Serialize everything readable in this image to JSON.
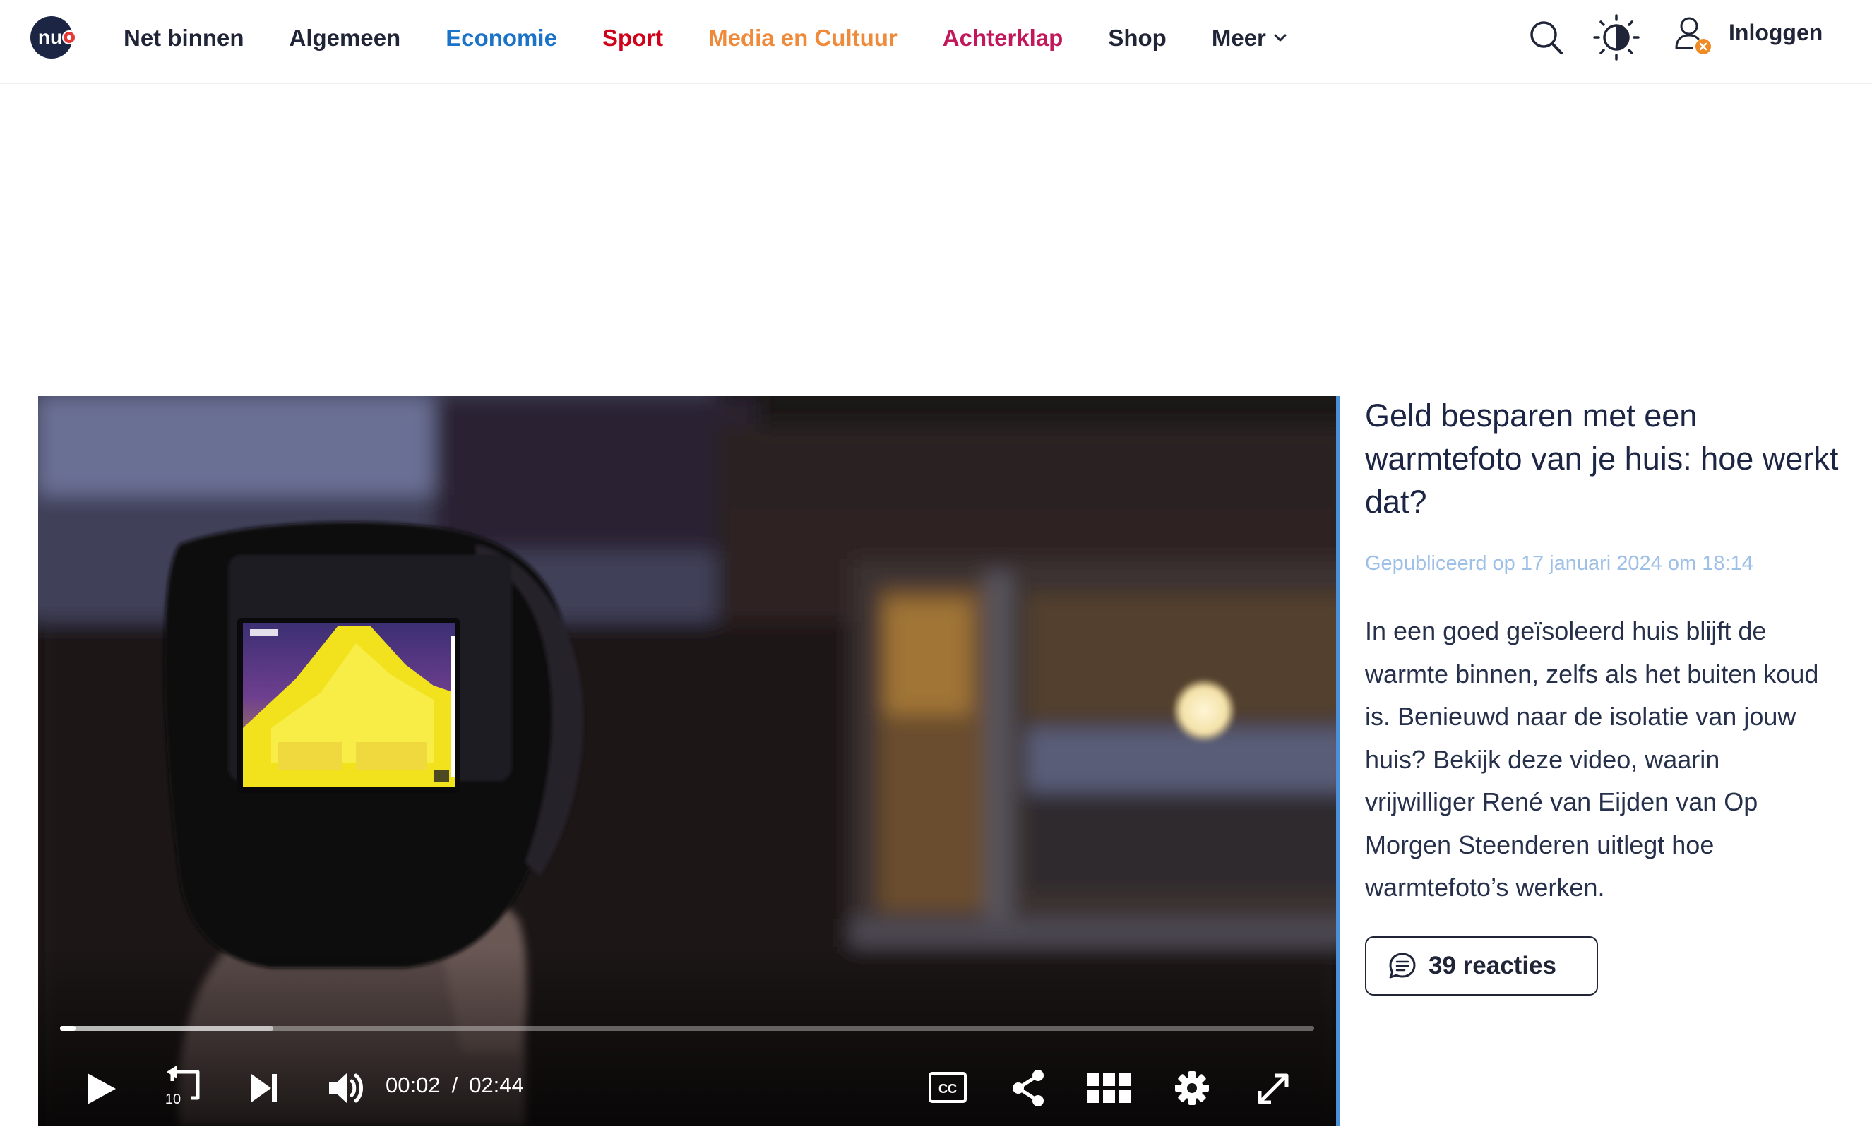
{
  "header": {
    "logo_text": "nu",
    "nav": [
      {
        "label": "Net binnen",
        "color": "#1f2437"
      },
      {
        "label": "Algemeen",
        "color": "#1f2437"
      },
      {
        "label": "Economie",
        "color": "#1a73c9"
      },
      {
        "label": "Sport",
        "color": "#d0021b"
      },
      {
        "label": "Media en Cultuur",
        "color": "#ee8a3a"
      },
      {
        "label": "Achterklap",
        "color": "#c2185b"
      },
      {
        "label": "Shop",
        "color": "#1f2437"
      },
      {
        "label": "Meer",
        "color": "#1f2437"
      }
    ],
    "login_label": "Inloggen",
    "icons": [
      "search-icon",
      "theme-toggle-icon",
      "user-icon"
    ]
  },
  "video": {
    "current_time": "00:02",
    "separator": "/",
    "duration": "02:44",
    "progress_fraction": 0.0122,
    "buffered_fraction": 0.17,
    "controls": [
      "play-icon",
      "rewind-10-icon",
      "skip-next-icon",
      "volume-icon",
      "captions-icon",
      "share-icon",
      "grid-icon",
      "settings-icon",
      "fullscreen-icon"
    ],
    "rewind_seconds": "10",
    "captions_label": "CC"
  },
  "article": {
    "title": "Geld besparen met een warmtefoto van je huis: hoe werkt dat?",
    "published": "Gepubliceerd op 17 januari 2024 om 18:14",
    "intro": "In een goed geïsoleerd huis blijft de warmte binnen, zelfs als het buiten koud is. Benieuwd naar de isolatie van jouw huis? Bekijk deze video, waarin vrijwilliger René van Eijden van Op Morgen Steenderen uitlegt hoe warmtefoto’s werken.",
    "comments_label": "39 reacties"
  },
  "colors": {
    "accent_blue": "#4a90d9",
    "text_dark": "#1f2437",
    "published_color": "#9fc0e6",
    "logo_bg": "#1c2543",
    "logo_dot": "#e53935"
  }
}
